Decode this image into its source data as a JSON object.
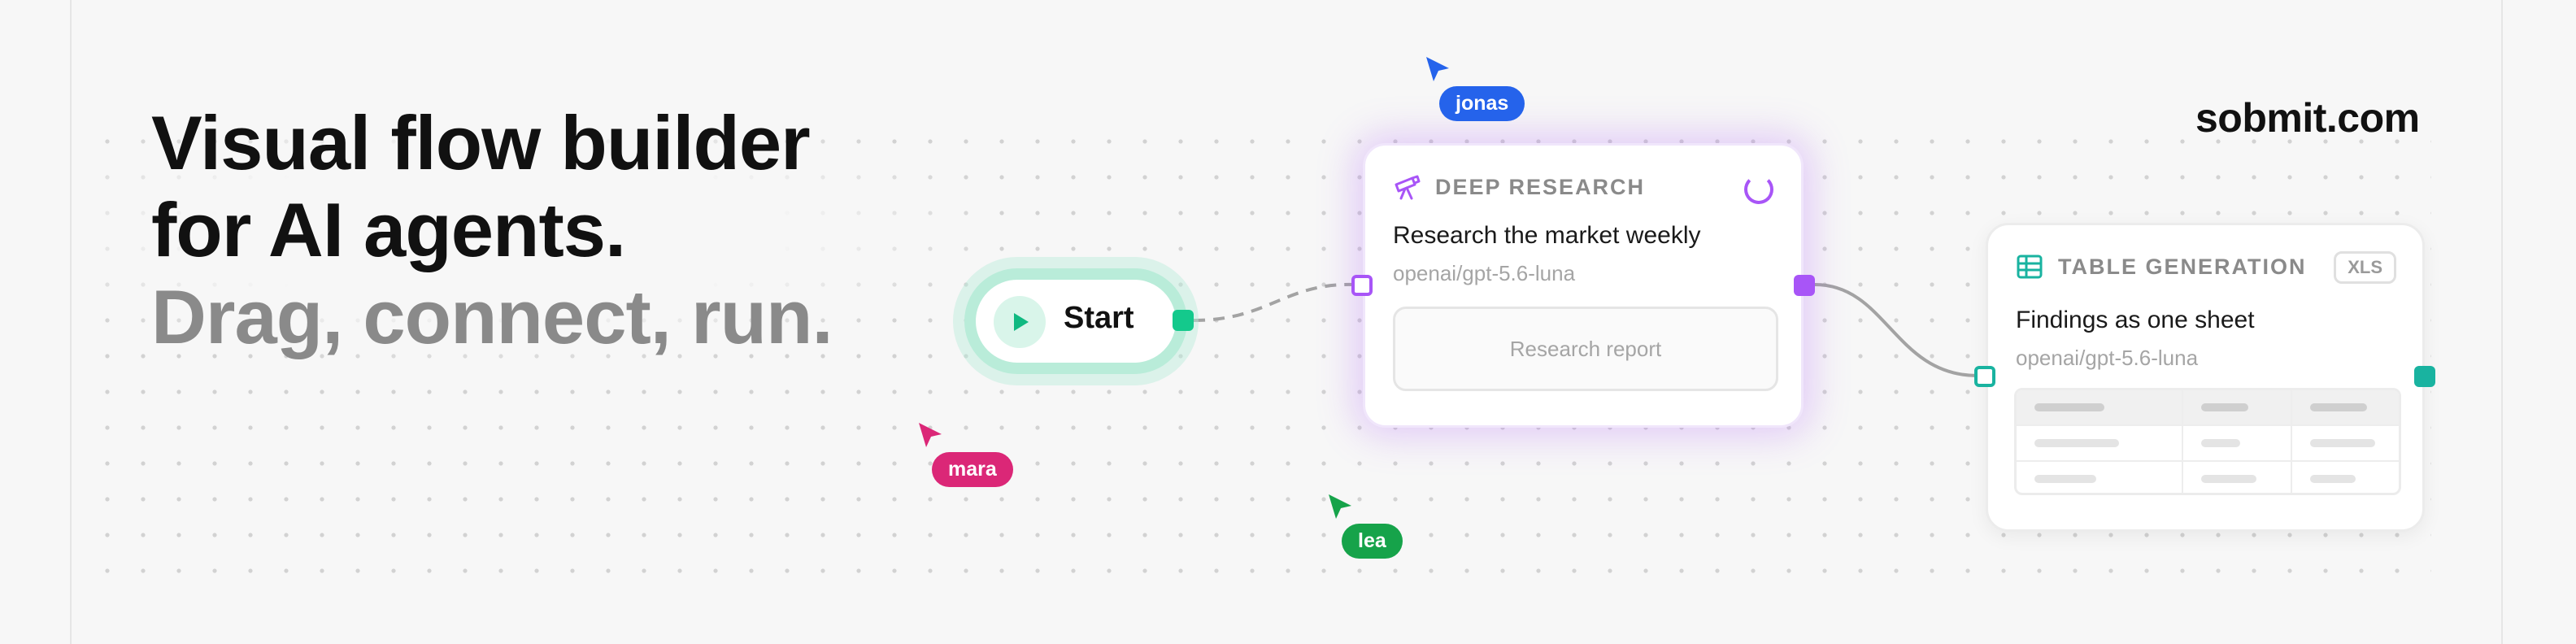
{
  "headline": {
    "line1": "Visual flow builder",
    "line2": "for AI agents.",
    "line3": "Drag, connect, run."
  },
  "brand": "sobmit.com",
  "start_node": {
    "label": "Start"
  },
  "research_card": {
    "kicker": "DEEP RESEARCH",
    "title": "Research the market weekly",
    "model": "openai/gpt-5.6-luna",
    "output": "Research report"
  },
  "table_card": {
    "kicker": "TABLE GENERATION",
    "badge": "XLS",
    "title": "Findings as one sheet",
    "model": "openai/gpt-5.6-luna"
  },
  "cursors": {
    "jonas": {
      "name": "jonas",
      "color": "#2563eb"
    },
    "mara": {
      "name": "mara",
      "color": "#db2777"
    },
    "lea": {
      "name": "lea",
      "color": "#16a34a"
    }
  },
  "colors": {
    "start_accent": "#10b981",
    "research_accent": "#a855f7",
    "table_accent": "#19b3a0"
  }
}
